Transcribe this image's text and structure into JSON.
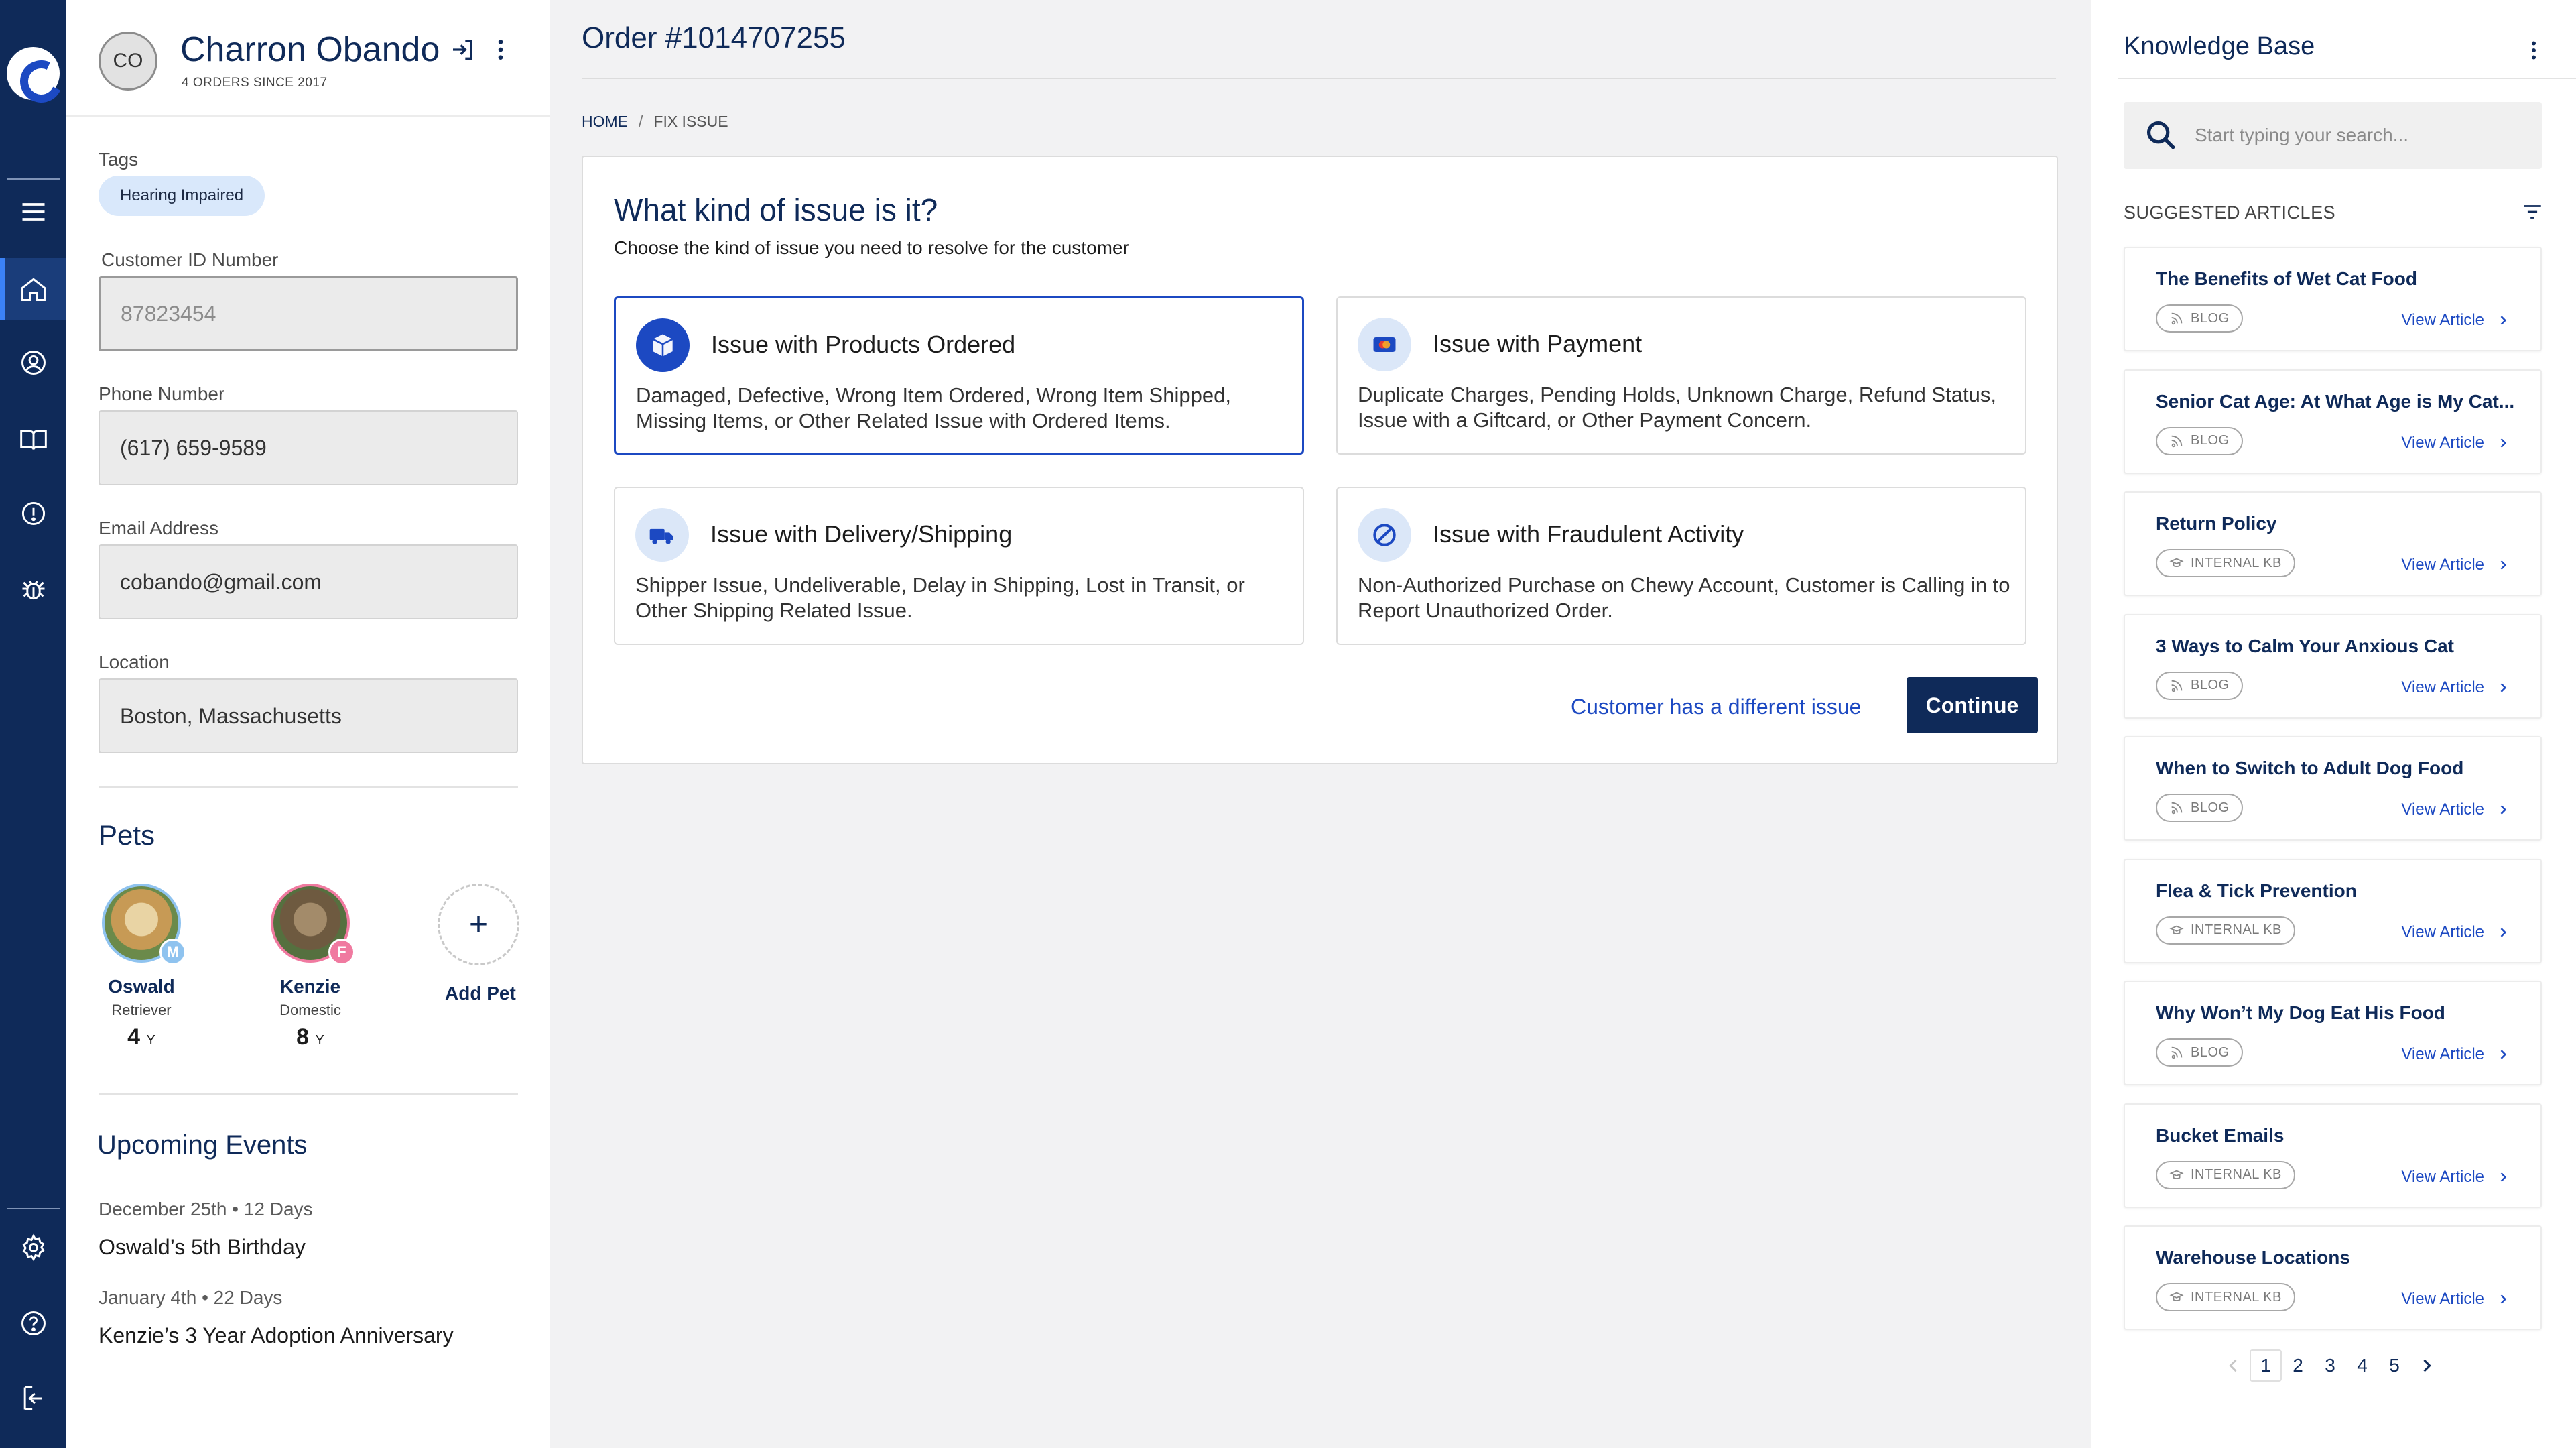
{
  "customer": {
    "initials": "CO",
    "name": "Charron Obando",
    "subtitle": "4 ORDERS SINCE 2017",
    "tags_label": "Tags",
    "tag": "Hearing Impaired",
    "customer_id_label": "Customer ID Number",
    "customer_id": "87823454",
    "phone_label": "Phone Number",
    "phone": "(617) 659-9589",
    "email_label": "Email Address",
    "email": "cobando@gmail.com",
    "location_label": "Location",
    "location": "Boston, Massachusetts"
  },
  "pets": {
    "title": "Pets",
    "items": [
      {
        "name": "Oswald",
        "breed": "Retriever",
        "age": "4",
        "age_unit": "Y",
        "sex": "M",
        "sex_color": "#8fc3ef"
      },
      {
        "name": "Kenzie",
        "breed": "Domestic",
        "age": "8",
        "age_unit": "Y",
        "sex": "F",
        "sex_color": "#f07aa0"
      }
    ],
    "add_symbol": "+",
    "add_label": "Add Pet"
  },
  "events": {
    "title": "Upcoming Events",
    "items": [
      {
        "date": "December 25th • 12 Days",
        "title": "Oswald’s 5th Birthday"
      },
      {
        "date": "January 4th • 22 Days",
        "title": "Kenzie’s 3 Year Adoption Anniversary"
      }
    ]
  },
  "order": {
    "title": "Order #1014707255",
    "breadcrumb": {
      "home": "HOME",
      "separator": "/",
      "current": "FIX ISSUE"
    }
  },
  "issue": {
    "title": "What kind of issue is it?",
    "subtitle": "Choose the kind of issue you need to resolve for the customer",
    "options": [
      {
        "icon": "package-icon",
        "title": "Issue with Products Ordered",
        "desc": "Damaged, Defective, Wrong Item Ordered, Wrong Item Shipped, Missing Items, or Other Related Issue with Ordered Items.",
        "selected": true
      },
      {
        "icon": "credit-card-icon",
        "title": "Issue with Payment",
        "desc": "Duplicate Charges, Pending Holds, Unknown Charge, Refund Status, Issue with a Giftcard, or Other Payment Concern.",
        "selected": false
      },
      {
        "icon": "delivery-truck-icon",
        "title": "Issue with Delivery/Shipping",
        "desc": "Shipper Issue, Undeliverable, Delay in Shipping, Lost in Transit, or Other Shipping Related Issue.",
        "selected": false
      },
      {
        "icon": "prohibited-icon",
        "title": "Issue with Fraudulent Activity",
        "desc": "Non-Authorized Purchase on Chewy Account, Customer is Calling in to Report Unauthorized Order.",
        "selected": false
      }
    ],
    "different_issue_link": "Customer has a different issue",
    "continue_label": "Continue"
  },
  "kb": {
    "title": "Knowledge Base",
    "search_placeholder": "Start typing your search...",
    "suggested_label": "SUGGESTED ARTICLES",
    "view_label": "View Article",
    "articles": [
      {
        "title": "The Benefits of Wet Cat Food",
        "type": "BLOG"
      },
      {
        "title": "Senior Cat Age: At What Age is My Cat...",
        "type": "BLOG"
      },
      {
        "title": "Return Policy",
        "type": "INTERNAL KB"
      },
      {
        "title": "3 Ways to Calm Your Anxious Cat",
        "type": "BLOG"
      },
      {
        "title": "When to Switch to Adult Dog Food",
        "type": "BLOG"
      },
      {
        "title": "Flea & Tick Prevention",
        "type": "INTERNAL KB"
      },
      {
        "title": "Why Won’t My Dog Eat His Food",
        "type": "BLOG"
      },
      {
        "title": "Bucket Emails",
        "type": "INTERNAL KB"
      },
      {
        "title": "Warehouse Locations",
        "type": "INTERNAL KB"
      }
    ],
    "pages": [
      "1",
      "2",
      "3",
      "4",
      "5"
    ],
    "current_page": "1"
  },
  "colors": {
    "navy": "#0f2a59",
    "accent_blue": "#1c49c2",
    "rail_active": "#1a3d7a"
  }
}
